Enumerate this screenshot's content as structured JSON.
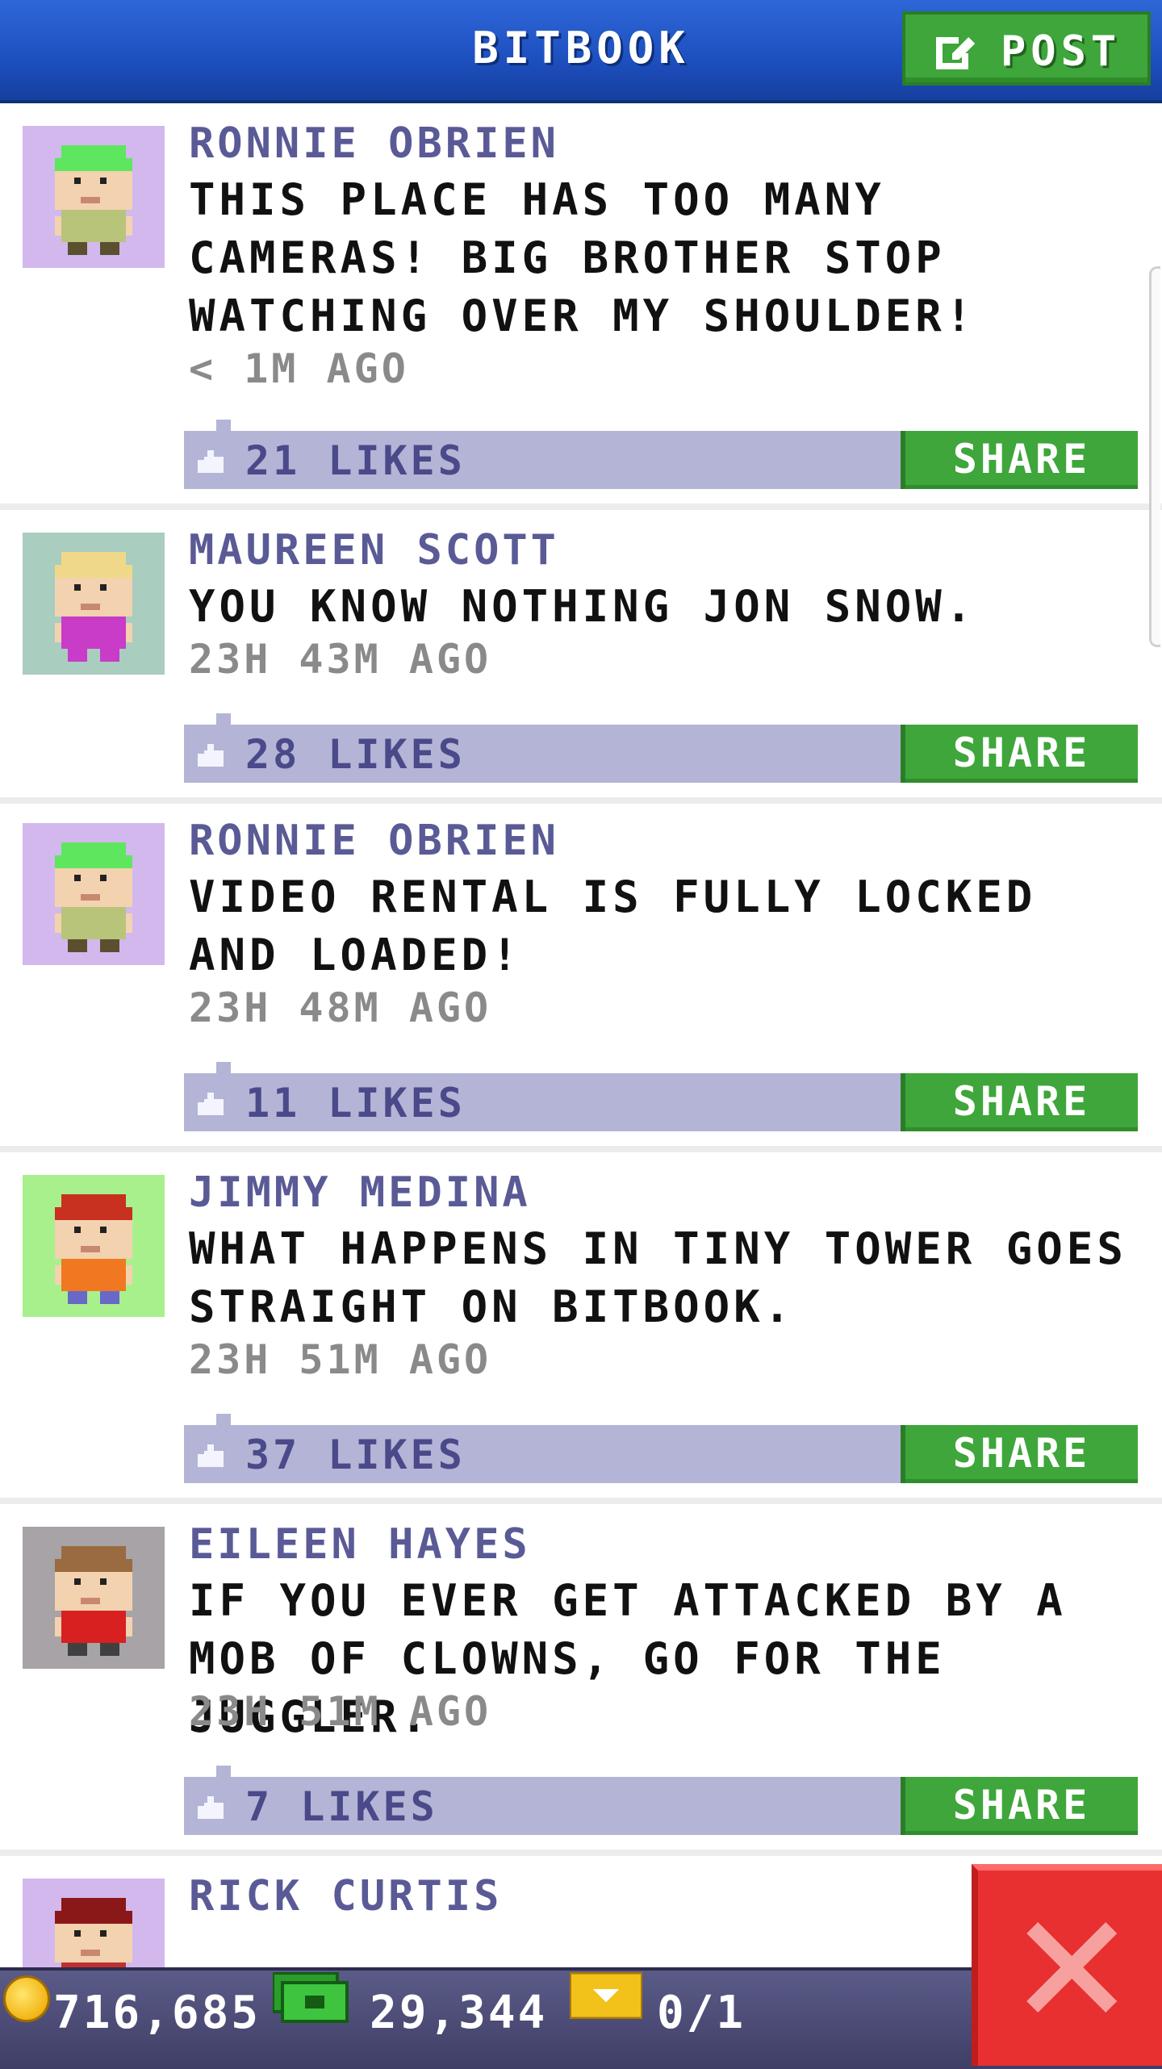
{
  "header": {
    "title": "BITBOOK",
    "post_label": "POST",
    "color": "#1d4fbf"
  },
  "feed": {
    "posts": [
      {
        "name": "RONNIE OBRIEN",
        "message": "THIS PLACE HAS TOO MANY CAMERAS! BIG BROTHER STOP WATCHING OVER MY SHOULDER!",
        "time": "< 1M AGO",
        "likes": "21 LIKES",
        "share_label": "SHARE",
        "avatar": {
          "name": "ronnie-obrien",
          "bg": "#d2b8ec",
          "hair": "#5ee65e",
          "shirt": "#b8c47a",
          "pants": "#5a5030"
        }
      },
      {
        "name": "MAUREEN SCOTT",
        "message": "YOU KNOW NOTHING JON SNOW.",
        "time": "23H 43M AGO",
        "likes": "28 LIKES",
        "share_label": "SHARE",
        "avatar": {
          "name": "maureen-scott",
          "bg": "#a9cdbf",
          "hair": "#f0d88a",
          "shirt": "#c83cc8",
          "pants": "#c83cc8"
        }
      },
      {
        "name": "RONNIE OBRIEN",
        "message": "VIDEO RENTAL IS FULLY LOCKED AND LOADED!",
        "time": "23H 48M AGO",
        "likes": "11 LIKES",
        "share_label": "SHARE",
        "avatar": {
          "name": "ronnie-obrien",
          "bg": "#d2b8ec",
          "hair": "#5ee65e",
          "shirt": "#b8c47a",
          "pants": "#5a5030"
        }
      },
      {
        "name": "JIMMY MEDINA",
        "message": "WHAT HAPPENS IN TINY TOWER GOES STRAIGHT ON BITBOOK.",
        "time": "23H 51M AGO",
        "likes": "37 LIKES",
        "share_label": "SHARE",
        "avatar": {
          "name": "jimmy-medina",
          "bg": "#a8f08c",
          "hair": "#c83020",
          "shirt": "#f07820",
          "pants": "#6868c8"
        }
      },
      {
        "name": "EILEEN HAYES",
        "message": "IF YOU EVER GET ATTACKED BY A MOB OF CLOWNS, GO FOR THE JUGGLER.",
        "time": "23H 51M AGO",
        "likes": "7 LIKES",
        "share_label": "SHARE",
        "avatar": {
          "name": "eileen-hayes",
          "bg": "#a7a3a7",
          "hair": "#9a6a40",
          "shirt": "#d82020",
          "pants": "#404040"
        }
      },
      {
        "name": "RICK CURTIS",
        "message": "",
        "time": "",
        "likes": "",
        "share_label": "",
        "avatar": {
          "name": "rick-curtis",
          "bg": "#d2b8ec",
          "hair": "#8a1818",
          "shirt": "#c03030",
          "pants": "#404040"
        }
      }
    ]
  },
  "bottom_bar": {
    "coins": "716,685",
    "bux": "29,344",
    "tickets": "0/1",
    "coin_icon": "coin-icon",
    "bux_icon": "cash-icon",
    "ticket_icon": "ticket-icon"
  },
  "close_button": {
    "icon": "close-icon",
    "color": "#e83030"
  },
  "colors": {
    "share_green": "#3ea63a",
    "likes_bar": "#b4b4d6",
    "name_color": "#5a5a96"
  }
}
